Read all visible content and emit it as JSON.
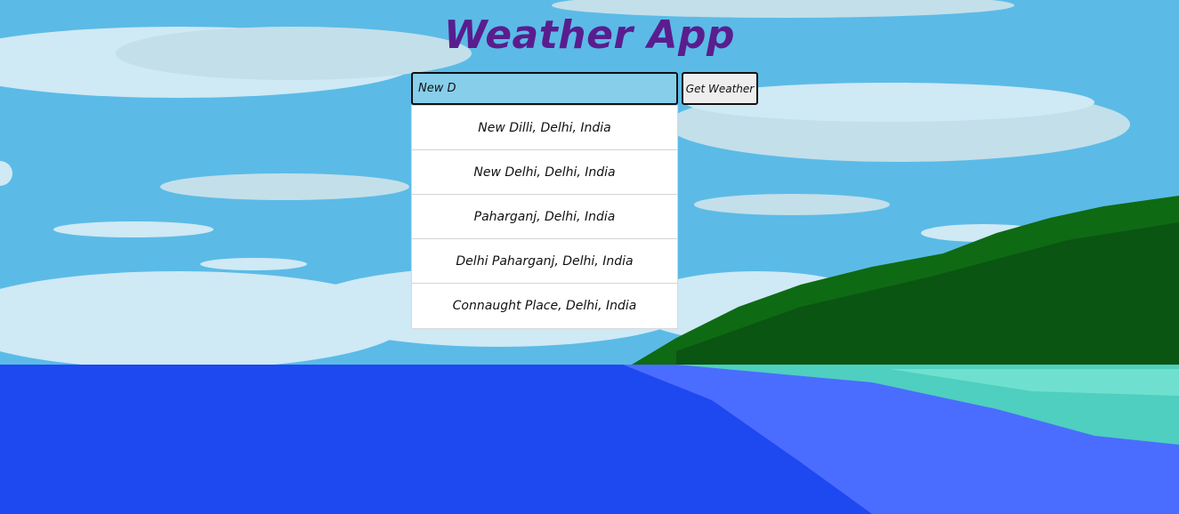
{
  "app": {
    "title": "Weather App"
  },
  "search": {
    "value": "New D",
    "button_label": "Get Weather"
  },
  "suggestions": [
    "New Dilli, Delhi, India",
    "New Delhi, Delhi, India",
    "Paharganj, Delhi, India",
    "Delhi Paharganj, Delhi, India",
    "Connaught Place, Delhi, India"
  ],
  "colors": {
    "title": "#5a1d8e",
    "sky": "#5bbbe6",
    "sea": "#1e48f0",
    "input_bg": "#87ceeb",
    "forest": "#0f6a14"
  }
}
